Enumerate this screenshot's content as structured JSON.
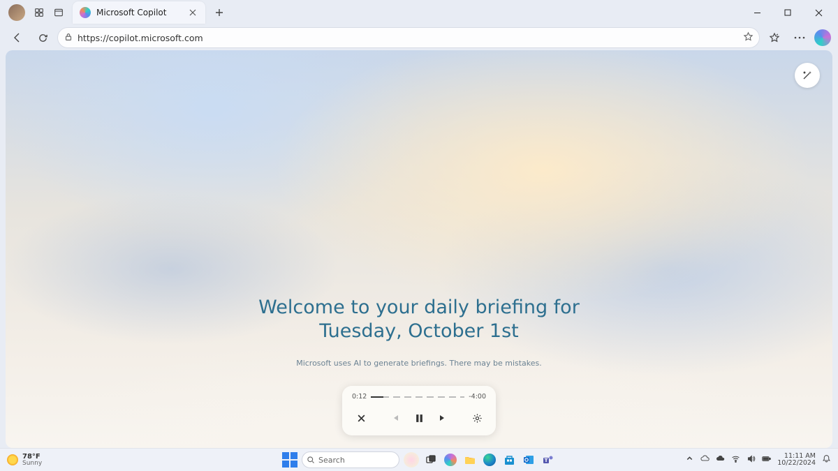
{
  "browser": {
    "tab_title": "Microsoft Copilot",
    "url": "https://copilot.microsoft.com"
  },
  "page": {
    "heading_l1": "Welcome to your daily briefing for",
    "heading_l2": "Tuesday, October 1st",
    "disclaimer": "Microsoft uses AI to generate briefings. There may be mistakes."
  },
  "player": {
    "elapsed": "0:12",
    "remaining": "-4:00"
  },
  "taskbar": {
    "temp": "78°F",
    "condition": "Sunny",
    "search_placeholder": "Search",
    "time": "11:11 AM",
    "date": "10/22/2024"
  }
}
